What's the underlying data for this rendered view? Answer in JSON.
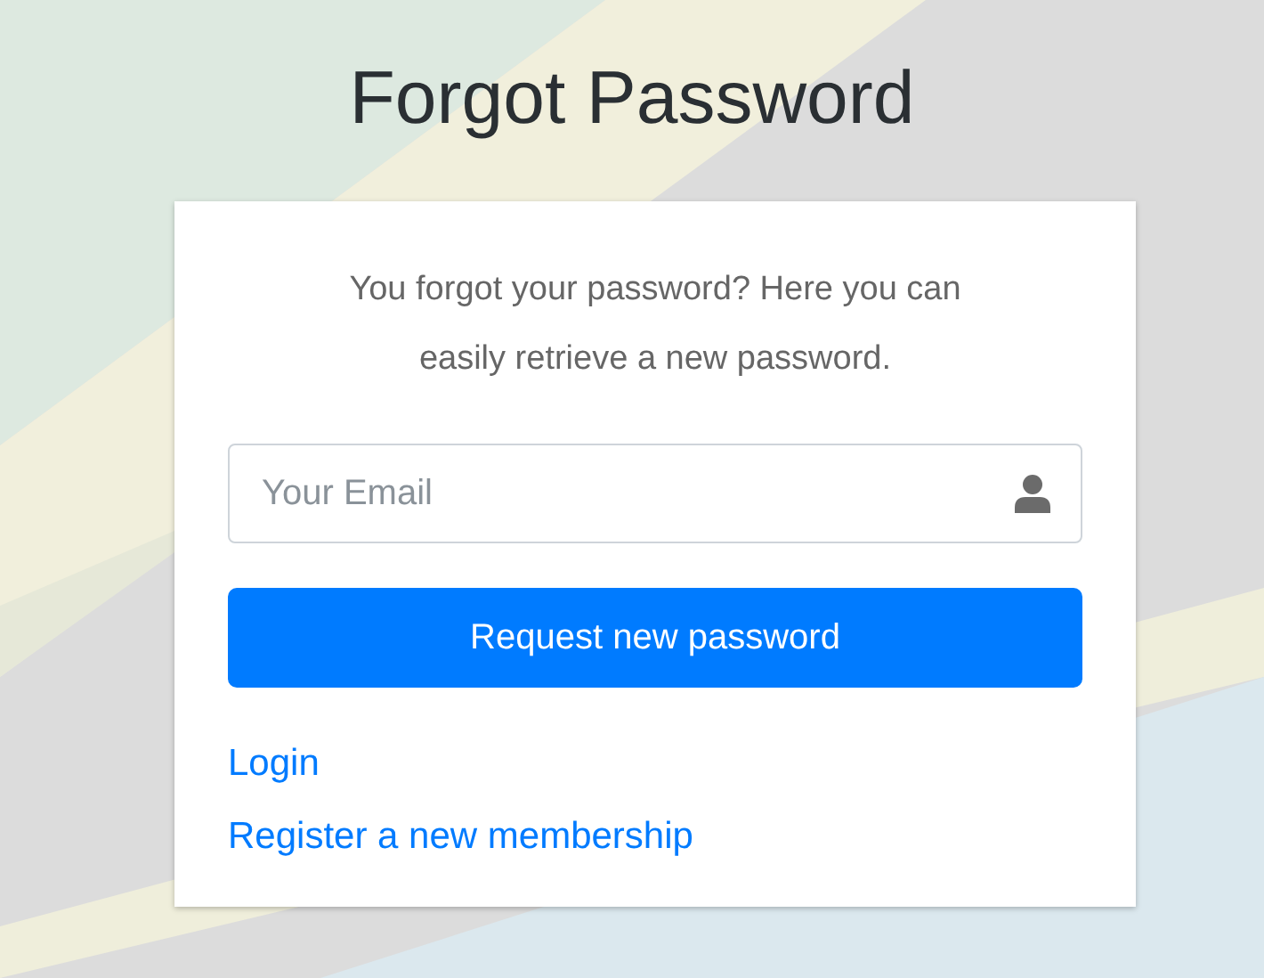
{
  "title": "Forgot Password",
  "card": {
    "message": "You forgot your password? Here you can easily retrieve a new password.",
    "email_field": {
      "placeholder": "Your Email"
    },
    "submit_button": "Request new password",
    "links": [
      "Login",
      "Register a new membership"
    ]
  }
}
